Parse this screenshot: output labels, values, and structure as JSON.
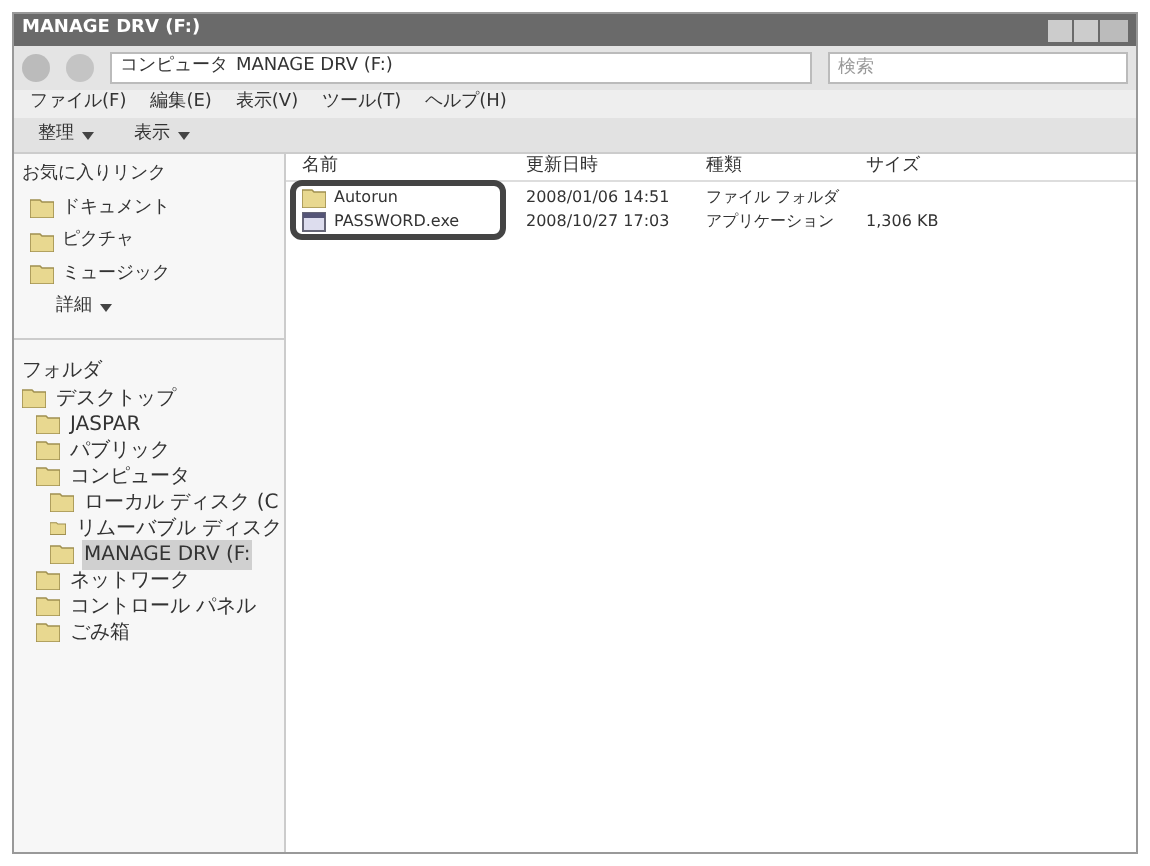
{
  "window": {
    "title": "MANAGE DRV (F:)"
  },
  "address": {
    "crumbs": [
      "コンピュータ",
      "MANAGE DRV (F:)"
    ]
  },
  "search": {
    "placeholder": "検索"
  },
  "menu": [
    "ファイル(F)",
    "編集(E)",
    "表示(V)",
    "ツール(T)",
    "ヘルプ(H)"
  ],
  "toolbar": [
    "整理",
    "表示"
  ],
  "favorites": {
    "title": "お気に入りリンク",
    "items": [
      "ドキュメント",
      "ピクチャ",
      "ミュージック"
    ],
    "more": "詳細"
  },
  "folders": {
    "title": "フォルダ",
    "tree": [
      {
        "label": "デスクトップ",
        "selected": false,
        "children": [
          {
            "label": "JASPAR",
            "selected": false
          },
          {
            "label": "パブリック",
            "selected": false
          },
          {
            "label": "コンピュータ",
            "selected": false,
            "children": [
              {
                "label": "ローカル ディスク (C",
                "selected": false
              },
              {
                "label": "リムーバブル ディスク",
                "selected": false
              },
              {
                "label": "MANAGE DRV (F:",
                "selected": true
              }
            ]
          },
          {
            "label": "ネットワーク",
            "selected": false
          },
          {
            "label": "コントロール パネル",
            "selected": false
          },
          {
            "label": "ごみ箱",
            "selected": false
          }
        ]
      }
    ]
  },
  "table": {
    "columns": [
      "名前",
      "更新日時",
      "種類",
      "サイズ"
    ],
    "rows": [
      {
        "kind": "folder",
        "name": "Autorun",
        "date": "2008/01/06 14:51",
        "type": "ファイル フォルダ"
      },
      {
        "kind": "app",
        "name": "PASSWORD.exe",
        "date": "2008/10/27 17:03",
        "type": "アプリケーション",
        "size": "1,306 KB"
      }
    ]
  }
}
